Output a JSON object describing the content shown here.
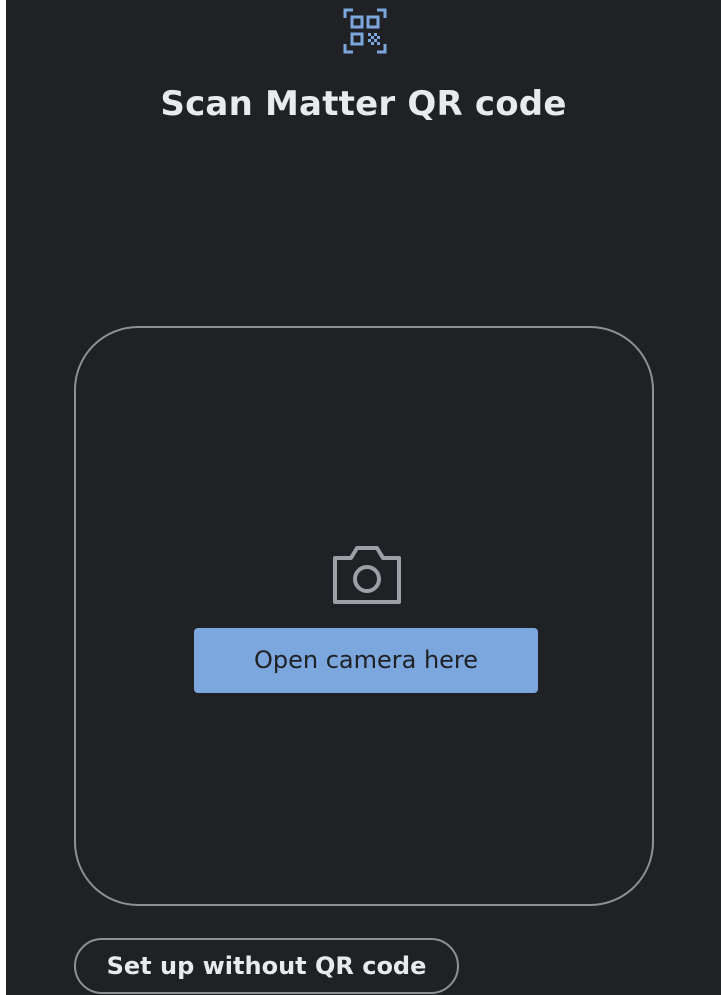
{
  "header": {
    "icon": "qr-code-scanner-icon",
    "title": "Scan Matter QR code"
  },
  "camera_panel": {
    "icon": "camera-icon",
    "open_camera_label": "Open camera here"
  },
  "footer": {
    "setup_without_qr_label": "Set up without QR code"
  },
  "colors": {
    "background": "#202124",
    "text": "#e8eaed",
    "accent": "#7ba6de",
    "outline": "#8e9094",
    "icon_gray": "#9aa0a6"
  }
}
